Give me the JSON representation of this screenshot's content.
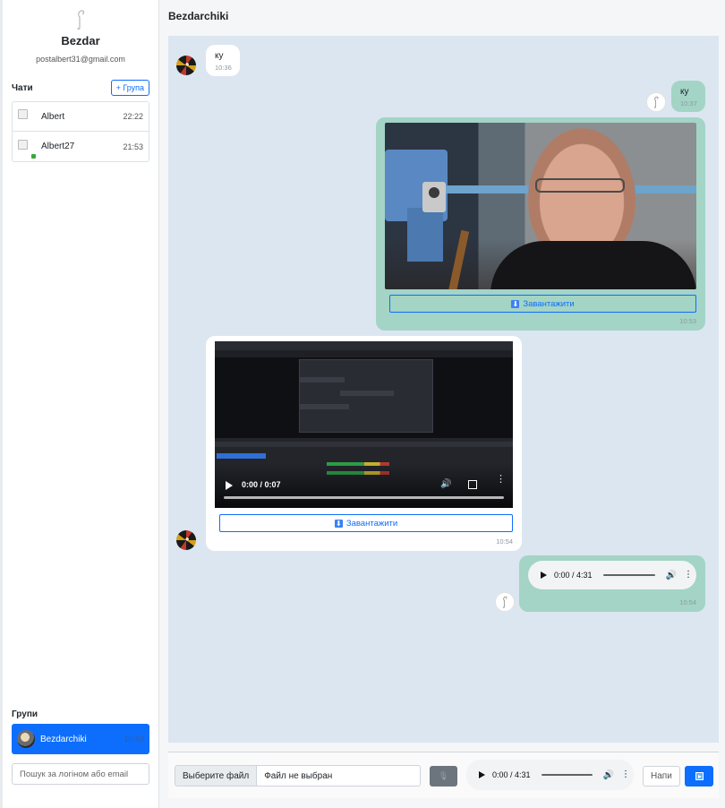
{
  "profile": {
    "name": "Bezdar",
    "email": "postalbert31@gmail.com",
    "avatar_icon": "hook-icon"
  },
  "sidebar": {
    "chats_title": "Чати",
    "group_button": "+ Група",
    "chats": [
      {
        "name": "Albert",
        "time": "22:22"
      },
      {
        "name": "Albert27",
        "time": "21:53"
      }
    ],
    "groups_title": "Групи",
    "groups": [
      {
        "name": "Bezdarchiki",
        "time": "10:54"
      }
    ],
    "search_placeholder": "Пошук за логіном або email"
  },
  "chat": {
    "title": "Bezdarchiki",
    "messages": [
      {
        "direction": "in",
        "type": "text",
        "text": "ку",
        "time": "10:36"
      },
      {
        "direction": "out",
        "type": "text",
        "text": "ку",
        "time": "10:37"
      },
      {
        "direction": "out",
        "type": "image",
        "download_label": "Завантажити",
        "time": "10:53"
      },
      {
        "direction": "in",
        "type": "video",
        "player_time": "0:00 / 0:07",
        "download_label": "Завантажити",
        "time": "10:54"
      },
      {
        "direction": "out",
        "type": "audio",
        "player_time": "0:00 / 4:31",
        "time": "10:54"
      }
    ]
  },
  "composer": {
    "file_button": "Выберите файл",
    "file_status": "Файл не выбран",
    "audio_time": "0:00 / 4:31",
    "message_placeholder": "Напи",
    "send_icon": "send-icon",
    "mic_icon": "mic-icon"
  },
  "colors": {
    "accent": "#0d6efd",
    "chat_background": "#dbe6f0",
    "outgoing_bubble": "#a3d4c6",
    "incoming_bubble": "#ffffff"
  }
}
